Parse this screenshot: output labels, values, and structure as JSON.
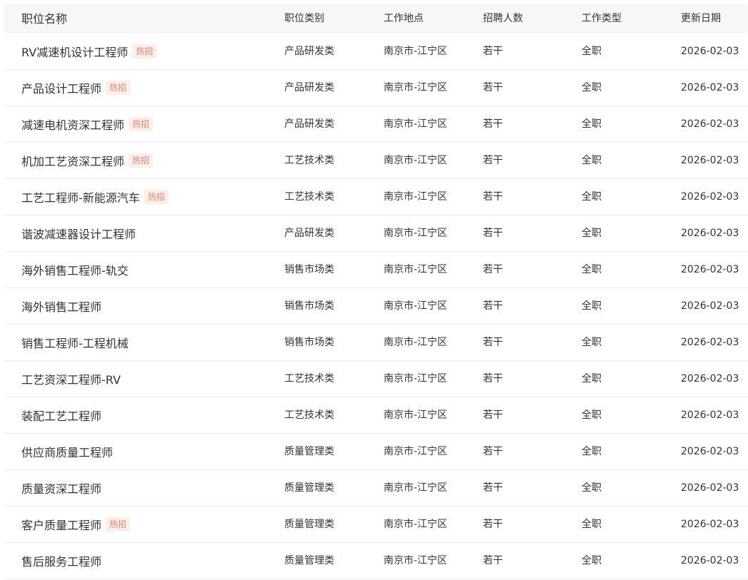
{
  "table": {
    "headers": {
      "name": "职位名称",
      "category": "职位类别",
      "location": "工作地点",
      "headcount": "招聘人数",
      "work_type": "工作类型",
      "updated": "更新日期"
    },
    "hot_label": "热招",
    "rows": [
      {
        "name": "RV减速机设计工程师",
        "hot": true,
        "category": "产品研发类",
        "location": "南京市-江宁区",
        "headcount": "若干",
        "work_type": "全职",
        "updated": "2026-02-03"
      },
      {
        "name": "产品设计工程师",
        "hot": true,
        "category": "产品研发类",
        "location": "南京市-江宁区",
        "headcount": "若干",
        "work_type": "全职",
        "updated": "2026-02-03"
      },
      {
        "name": "减速电机资深工程师",
        "hot": true,
        "category": "产品研发类",
        "location": "南京市-江宁区",
        "headcount": "若干",
        "work_type": "全职",
        "updated": "2026-02-03"
      },
      {
        "name": "机加工艺资深工程师",
        "hot": true,
        "category": "工艺技术类",
        "location": "南京市-江宁区",
        "headcount": "若干",
        "work_type": "全职",
        "updated": "2026-02-03"
      },
      {
        "name": "工艺工程师-新能源汽车",
        "hot": true,
        "category": "工艺技术类",
        "location": "南京市-江宁区",
        "headcount": "若干",
        "work_type": "全职",
        "updated": "2026-02-03"
      },
      {
        "name": "谐波减速器设计工程师",
        "hot": false,
        "category": "产品研发类",
        "location": "南京市-江宁区",
        "headcount": "若干",
        "work_type": "全职",
        "updated": "2026-02-03"
      },
      {
        "name": "海外销售工程师-轨交",
        "hot": false,
        "category": "销售市场类",
        "location": "南京市-江宁区",
        "headcount": "若干",
        "work_type": "全职",
        "updated": "2026-02-03"
      },
      {
        "name": "海外销售工程师",
        "hot": false,
        "category": "销售市场类",
        "location": "南京市-江宁区",
        "headcount": "若干",
        "work_type": "全职",
        "updated": "2026-02-03"
      },
      {
        "name": "销售工程师-工程机械",
        "hot": false,
        "category": "销售市场类",
        "location": "南京市-江宁区",
        "headcount": "若干",
        "work_type": "全职",
        "updated": "2026-02-03"
      },
      {
        "name": "工艺资深工程师-RV",
        "hot": false,
        "category": "工艺技术类",
        "location": "南京市-江宁区",
        "headcount": "若干",
        "work_type": "全职",
        "updated": "2026-02-03"
      },
      {
        "name": "装配工艺工程师",
        "hot": false,
        "category": "工艺技术类",
        "location": "南京市-江宁区",
        "headcount": "若干",
        "work_type": "全职",
        "updated": "2026-02-03"
      },
      {
        "name": "供应商质量工程师",
        "hot": false,
        "category": "质量管理类",
        "location": "南京市-江宁区",
        "headcount": "若干",
        "work_type": "全职",
        "updated": "2026-02-03"
      },
      {
        "name": "质量资深工程师",
        "hot": false,
        "category": "质量管理类",
        "location": "南京市-江宁区",
        "headcount": "若干",
        "work_type": "全职",
        "updated": "2026-02-03"
      },
      {
        "name": "客户质量工程师",
        "hot": true,
        "category": "质量管理类",
        "location": "南京市-江宁区",
        "headcount": "若干",
        "work_type": "全职",
        "updated": "2026-02-03"
      },
      {
        "name": "售后服务工程师",
        "hot": false,
        "category": "质量管理类",
        "location": "南京市-江宁区",
        "headcount": "若干",
        "work_type": "全职",
        "updated": "2026-02-03"
      }
    ]
  }
}
